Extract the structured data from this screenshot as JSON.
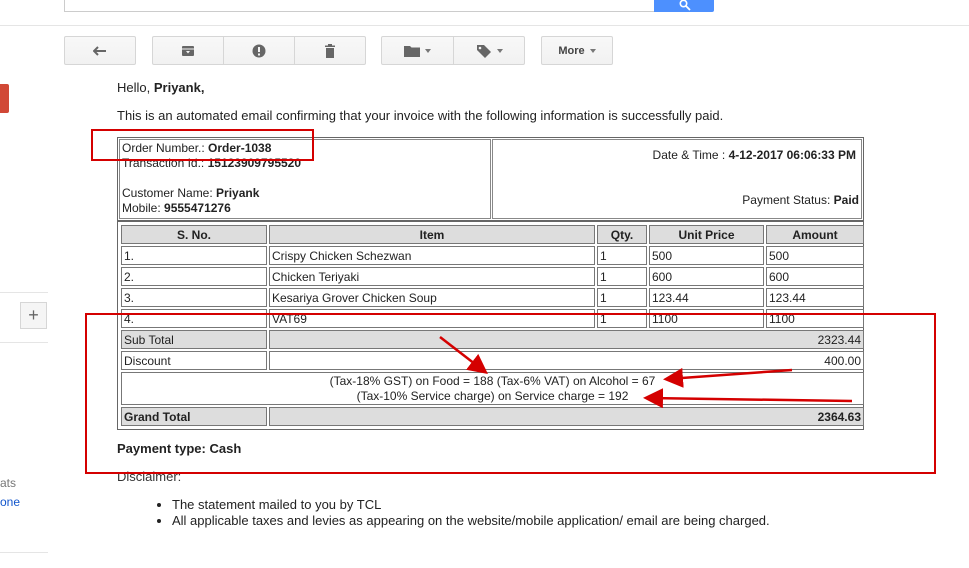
{
  "toolbar": {
    "more_label": "More"
  },
  "sidebar": {
    "add_label": "+",
    "text_1": "ats",
    "text_2": "one"
  },
  "email": {
    "greeting_prefix": "Hello, ",
    "greeting_name": "Priyank,",
    "intro": "This is an automated email confirming that your invoice with the following information is successfully paid."
  },
  "invoice": {
    "order_label": "Order Number.: ",
    "order_value": "Order-1038",
    "transaction_label": "Transaction Id.: ",
    "transaction_value": "15123909795520",
    "customer_label": "Customer Name: ",
    "customer_value": "Priyank",
    "mobile_label": "Mobile: ",
    "mobile_value": "9555471276",
    "datetime_label": "Date & Time : ",
    "datetime_value": "4-12-2017 06:06:33 PM",
    "status_label": "Payment Status: ",
    "status_value": "Paid",
    "columns": [
      "S. No.",
      "Item",
      "Qty.",
      "Unit Price",
      "Amount"
    ],
    "rows": [
      {
        "sno": "1.",
        "item": "Crispy Chicken Schezwan",
        "qty": "1",
        "unit": "500",
        "amount": "500"
      },
      {
        "sno": "2.",
        "item": "Chicken Teriyaki",
        "qty": "1",
        "unit": "600",
        "amount": "600"
      },
      {
        "sno": "3.",
        "item": "Kesariya Grover Chicken Soup",
        "qty": "1",
        "unit": "123.44",
        "amount": "123.44"
      },
      {
        "sno": "4.",
        "item": "VAT69",
        "qty": "1",
        "unit": "1100",
        "amount": "1100"
      }
    ],
    "subtotal_label": "Sub Total",
    "subtotal_value": "2323.44",
    "discount_label": "Discount",
    "discount_value": "400.00",
    "tax_line_1": "(Tax-18% GST) on Food = 188 (Tax-6% VAT) on Alcohol = 67",
    "tax_line_2": "(Tax-10% Service charge) on Service charge = 192",
    "grandtotal_label": "Grand Total",
    "grandtotal_value": "2364.63"
  },
  "payment_type": "Payment type: Cash",
  "disclaimer": {
    "title": "Disclaimer:",
    "items": [
      "The statement mailed to you by TCL",
      "All applicable taxes and levies as appearing on the website/mobile application/ email are being charged."
    ]
  },
  "colors": {
    "annotation": "#d40000",
    "search_button": "#4d90fe",
    "compose": "#d14836"
  }
}
